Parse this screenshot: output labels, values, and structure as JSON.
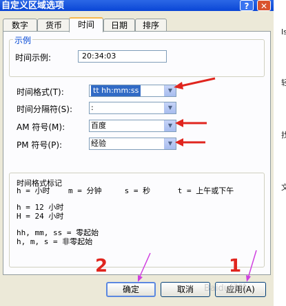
{
  "window": {
    "title": "自定义区域选项",
    "help_icon": "?",
    "close_icon": "✕"
  },
  "tabs": [
    {
      "label": "数字"
    },
    {
      "label": "货币"
    },
    {
      "label": "时间"
    },
    {
      "label": "日期"
    },
    {
      "label": "排序"
    }
  ],
  "active_tab": "时间",
  "sample": {
    "group_label": "示例",
    "label": "时间示例:",
    "value": "20:34:03"
  },
  "fields": {
    "time_format": {
      "label": "时间格式(T):",
      "value": "tt hh:mm:ss"
    },
    "separator": {
      "label": "时间分隔符(S):",
      "value": ":"
    },
    "am": {
      "label": "AM 符号(M):",
      "value": "百度"
    },
    "pm": {
      "label": "PM 符号(P):",
      "value": "经验"
    }
  },
  "notation": {
    "title": "时间格式标记",
    "line1": "h = 小时    m = 分钟     s = 秒      t = 上午或下午",
    "line2": "h = 12 小时",
    "line3": "H = 24 小时",
    "line4": "hh, mm, ss = 零起始",
    "line5": "h, m, s = 非零起始"
  },
  "buttons": {
    "ok": "确定",
    "cancel": "取消",
    "apply": "应用(A)"
  },
  "side_chars": [
    "Is",
    "轻",
    "找",
    "文"
  ],
  "annotations": {
    "number_2": "2",
    "number_1": "1"
  },
  "watermark": "Baidu经验",
  "colors": {
    "titlebar": "#0a46d6",
    "dialog_bg": "#ece9d8",
    "selection": "#316ac5",
    "arrow_red": "#e0251e",
    "arrow_magenta": "#d040e0"
  }
}
